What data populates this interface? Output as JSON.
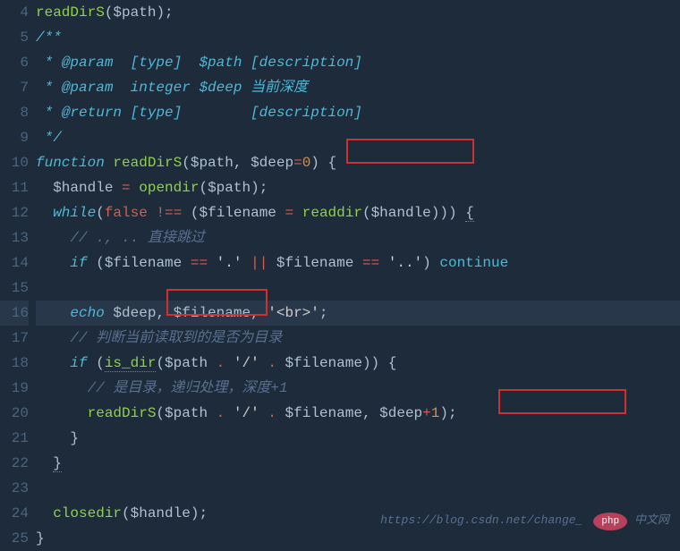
{
  "gutter": [
    "4",
    "5",
    "6",
    "7",
    "8",
    "9",
    "10",
    "11",
    "12",
    "13",
    "14",
    "15",
    "16",
    "17",
    "18",
    "19",
    "20",
    "21",
    "22",
    "23",
    "24",
    "25"
  ],
  "tokens": {
    "l4": {
      "fn": "readDirS",
      "var": "$path"
    },
    "l5": {
      "open": "/**"
    },
    "l6": {
      "star": " * ",
      "tag": "@param",
      "type": "  [type]  ",
      "var": "$path",
      "desc": " [description]"
    },
    "l7": {
      "star": " * ",
      "tag": "@param",
      "type": "  integer ",
      "var": "$deep",
      "desc": " 当前深度"
    },
    "l8": {
      "star": " * ",
      "tag": "@return",
      "type": " [type]",
      "desc": "        [description]"
    },
    "l9": {
      "close": " */"
    },
    "l10": {
      "fn_kw": "function",
      "fn": "readDirS",
      "p1": "$path",
      "p2": "$deep",
      "op": "=",
      "num": "0"
    },
    "l11": {
      "v1": "$handle",
      "op": "=",
      "fn": "opendir",
      "v2": "$path"
    },
    "l12": {
      "while": "while",
      "false": "false",
      "neq": "!==",
      "v1": "$filename",
      "eq": "=",
      "fn": "readdir",
      "v2": "$handle"
    },
    "l13": {
      "comment": "// ., .. 直接跳过"
    },
    "l14": {
      "if": "if",
      "v1": "$filename",
      "eq1": "==",
      "s1": "'.'",
      "or": "||",
      "v2": "$filename",
      "eq2": "==",
      "s2": "'..'",
      "cont": "continue"
    },
    "l16": {
      "echo": "echo",
      "v1": "$deep",
      "v2": "$filename",
      "s": "'<br>'"
    },
    "l17": {
      "comment": "// 判断当前读取到的是否为目录"
    },
    "l18": {
      "if": "if",
      "fn": "is_dir",
      "v1": "$path",
      "cat": ".",
      "s": "'/'",
      "cat2": ".",
      "v2": "$filename"
    },
    "l19": {
      "comment": "// 是目录，递归处理，深度+1"
    },
    "l20": {
      "fn": "readDirS",
      "v1": "$path",
      "cat": ".",
      "s": "'/'",
      "cat2": ".",
      "v2": "$filename",
      "v3": "$deep",
      "plus": "+",
      "num": "1"
    },
    "l24": {
      "fn": "closedir",
      "v": "$handle"
    }
  },
  "watermark": {
    "url": "https://blog.csdn.net/change_",
    "badge": "php",
    "cn": "中文网"
  }
}
